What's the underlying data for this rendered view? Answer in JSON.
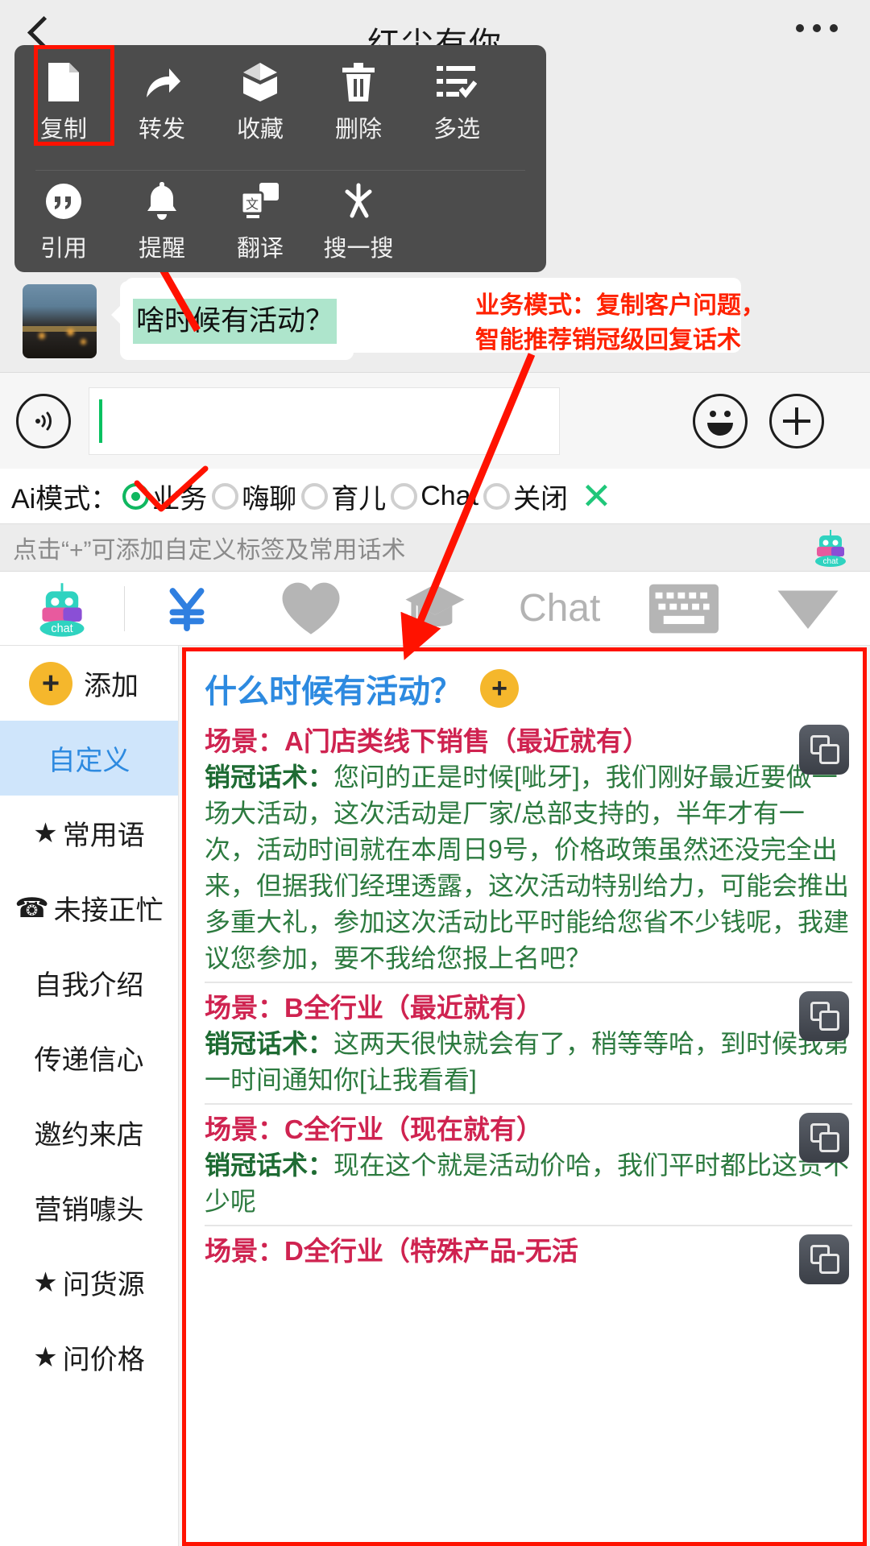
{
  "header": {
    "title": "红尘有你",
    "back_icon": "back-chevron-icon",
    "more_icon": "more-dots-icon"
  },
  "context_menu": {
    "row1": [
      {
        "label": "复制",
        "icon": "copy-icon",
        "highlighted": true
      },
      {
        "label": "转发",
        "icon": "forward-arrow-icon"
      },
      {
        "label": "收藏",
        "icon": "star-box-icon"
      },
      {
        "label": "删除",
        "icon": "trash-icon"
      },
      {
        "label": "多选",
        "icon": "multi-select-icon"
      }
    ],
    "row2": [
      {
        "label": "引用",
        "icon": "quote-icon"
      },
      {
        "label": "提醒",
        "icon": "bell-icon"
      },
      {
        "label": "翻译",
        "icon": "translate-icon"
      },
      {
        "label": "搜一搜",
        "icon": "search-sparkle-icon"
      }
    ]
  },
  "message": {
    "text": "啥时候有活动？",
    "avatar_name": "contact-avatar"
  },
  "annotation": {
    "line1": "业务模式：复制客户问题，",
    "line2": "智能推荐销冠级回复话术",
    "color": "#ff2200"
  },
  "input_bar": {
    "voice_icon": "voice-wave-icon",
    "input_value": "",
    "emoji_icon": "smiley-icon",
    "plus_icon": "plus-circle-icon"
  },
  "ai_mode": {
    "label": "Ai模式：",
    "options": [
      {
        "label": "业务",
        "selected": true
      },
      {
        "label": "嗨聊",
        "selected": false
      },
      {
        "label": "育儿",
        "selected": false
      },
      {
        "label": "Chat",
        "selected": false
      },
      {
        "label": "关闭",
        "selected": false
      }
    ],
    "close_icon": "close-x-icon",
    "accent": "#10b760"
  },
  "hint_bar": {
    "text": "点击“+”可添加自定义标签及常用话术",
    "bot_icon": "chat-robot-icon"
  },
  "tool_bar": {
    "items": [
      {
        "icon": "chat-robot-icon",
        "label": ""
      },
      {
        "icon": "yen-icon",
        "label": "¥"
      },
      {
        "icon": "heart-icon",
        "label": ""
      },
      {
        "icon": "graduation-cap-icon",
        "label": ""
      },
      {
        "icon": "chat-text-icon",
        "label": "Chat"
      },
      {
        "icon": "keyboard-icon",
        "label": ""
      },
      {
        "icon": "chevron-down-icon",
        "label": ""
      }
    ]
  },
  "sidebar": {
    "add_label": "添加",
    "items": [
      {
        "label": "自定义",
        "active": true,
        "prefix": ""
      },
      {
        "label": "常用语",
        "active": false,
        "prefix": "★"
      },
      {
        "label": "未接正忙",
        "active": false,
        "prefix": "☎"
      },
      {
        "label": "自我介绍",
        "active": false,
        "prefix": ""
      },
      {
        "label": "传递信心",
        "active": false,
        "prefix": ""
      },
      {
        "label": "邀约来店",
        "active": false,
        "prefix": ""
      },
      {
        "label": "营销噱头",
        "active": false,
        "prefix": ""
      },
      {
        "label": "问货源",
        "active": false,
        "prefix": "★"
      },
      {
        "label": "问价格",
        "active": false,
        "prefix": "★"
      }
    ]
  },
  "panel": {
    "question": "什么时候有活动？",
    "add_icon_label": "+",
    "sections": [
      {
        "scene": "场景：A门店类线下销售（最近就有）",
        "body_label": "销冠话术：",
        "body": "您问的正是时候[呲牙]，我们刚好最近要做一场大活动，这次活动是厂家/总部支持的，半年才有一次，活动时间就在本周日9号，价格政策虽然还没完全出来，但据我们经理透露，这次活动特别给力，可能会推出多重大礼，参加这次活动比平时能给您省不少钱呢，我建议您参加，要不我给您报上名吧？",
        "copy_icon": "copy-icon"
      },
      {
        "scene": "场景：B全行业（最近就有）",
        "body_label": "销冠话术：",
        "body": "这两天很快就会有了，稍等等哈，到时候我第一时间通知你[让我看看]",
        "copy_icon": "copy-icon"
      },
      {
        "scene": "场景：C全行业（现在就有）",
        "body_label": "销冠话术：",
        "body": "现在这个就是活动价哈，我们平时都比这贵不少呢",
        "copy_icon": "copy-icon"
      },
      {
        "scene": "场景：D全行业（特殊产品-无活",
        "body_label": "",
        "body": "",
        "copy_icon": "copy-icon"
      }
    ]
  }
}
